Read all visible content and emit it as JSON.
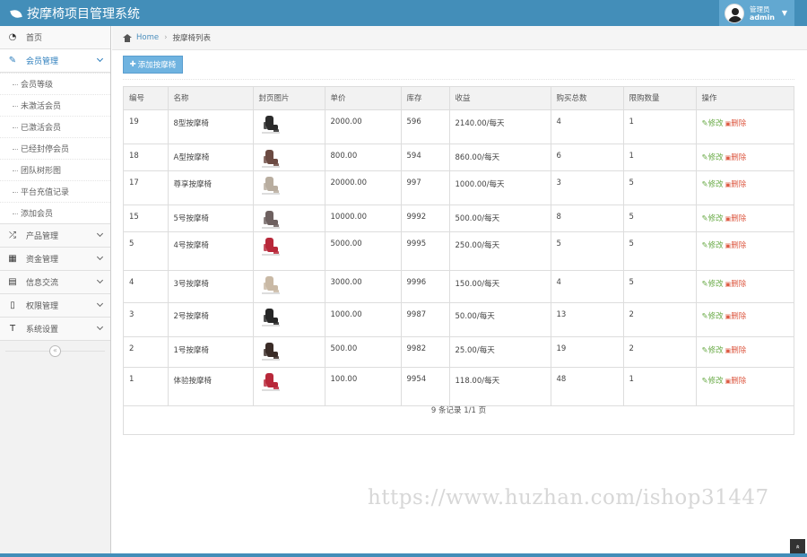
{
  "app": {
    "title": "按摩椅项目管理系统"
  },
  "user": {
    "role": "管理员",
    "name": "admin"
  },
  "sidebar": {
    "items": [
      {
        "label": "首页",
        "icon": "dashboard-icon"
      },
      {
        "label": "会员管理",
        "icon": "edit-icon",
        "open": true,
        "children": [
          "会员等级",
          "未激活会员",
          "已激活会员",
          "已经封停会员",
          "团队树形图",
          "平台充值记录",
          "添加会员"
        ]
      },
      {
        "label": "产品管理",
        "icon": "shuffle-icon"
      },
      {
        "label": "资金管理",
        "icon": "calendar-icon"
      },
      {
        "label": "信息交流",
        "icon": "list-alt-icon"
      },
      {
        "label": "权限管理",
        "icon": "file-icon"
      },
      {
        "label": "系统设置",
        "icon": "text-height-icon"
      }
    ],
    "collapse_symbol": "«"
  },
  "breadcrumb": {
    "home": "Home",
    "current": "按摩椅列表"
  },
  "toolbar": {
    "add_label": "添加按摩椅"
  },
  "table": {
    "headers": [
      "编号",
      "名称",
      "封页图片",
      "单价",
      "库存",
      "收益",
      "购买总数",
      "限购数量",
      "操作"
    ],
    "rows": [
      {
        "id": "19",
        "name": "8型按摩椅",
        "price": "2000.00",
        "stock": "596",
        "income": "2140.00/每天",
        "total": "4",
        "limit": "1",
        "color": "#2b2b2b"
      },
      {
        "id": "18",
        "name": "A型按摩椅",
        "price": "800.00",
        "stock": "594",
        "income": "860.00/每天",
        "total": "6",
        "limit": "1",
        "color": "#6b4a42"
      },
      {
        "id": "17",
        "name": "尊享按摩椅",
        "price": "20000.00",
        "stock": "997",
        "income": "1000.00/每天",
        "total": "3",
        "limit": "5",
        "color": "#b8ad9f"
      },
      {
        "id": "15",
        "name": "5号按摩椅",
        "price": "10000.00",
        "stock": "9992",
        "income": "500.00/每天",
        "total": "8",
        "limit": "5",
        "color": "#6e6160"
      },
      {
        "id": "5",
        "name": "4号按摩椅",
        "price": "5000.00",
        "stock": "9995",
        "income": "250.00/每天",
        "total": "5",
        "limit": "5",
        "color": "#b8283a"
      },
      {
        "id": "4",
        "name": "3号按摩椅",
        "price": "3000.00",
        "stock": "9996",
        "income": "150.00/每天",
        "total": "4",
        "limit": "5",
        "color": "#c9b9a5"
      },
      {
        "id": "3",
        "name": "2号按摩椅",
        "price": "1000.00",
        "stock": "9987",
        "income": "50.00/每天",
        "total": "13",
        "limit": "2",
        "color": "#262626"
      },
      {
        "id": "2",
        "name": "1号按摩椅",
        "price": "500.00",
        "stock": "9982",
        "income": "25.00/每天",
        "total": "19",
        "limit": "2",
        "color": "#3a2c27"
      },
      {
        "id": "1",
        "name": "体验按摩椅",
        "price": "100.00",
        "stock": "9954",
        "income": "118.00/每天",
        "total": "48",
        "limit": "1",
        "color": "#b8283a"
      }
    ],
    "edit_label": "修改",
    "delete_label": "删除",
    "summary": "9 条记录 1/1 页"
  },
  "watermark": "https://www.huzhan.com/ishop31447",
  "scroll_top_symbol": "»"
}
